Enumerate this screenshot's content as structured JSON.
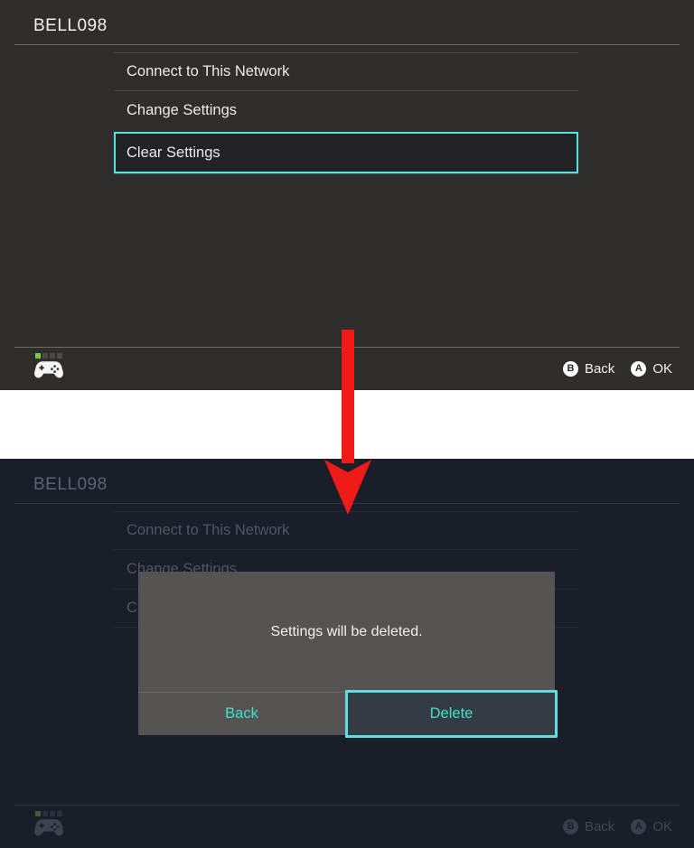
{
  "panels": [
    {
      "id": "menu-panel",
      "title": "BELL098",
      "menu": [
        {
          "label": "Connect to This Network",
          "selected": false
        },
        {
          "label": "Change Settings",
          "selected": false
        },
        {
          "label": "Clear Settings",
          "selected": true
        }
      ],
      "action_bar": {
        "controller_icon": "game-controller-icon",
        "player_leds": [
          true,
          false,
          false,
          false
        ],
        "hints": [
          {
            "button": "B",
            "label": "Back"
          },
          {
            "button": "A",
            "label": "OK"
          }
        ]
      }
    },
    {
      "id": "dialog-panel",
      "title": "BELL098",
      "menu": [
        {
          "label": "Connect to This Network",
          "selected": false
        },
        {
          "label": "Change Settings",
          "selected": false
        },
        {
          "label": "Clear Settings",
          "selected": false
        }
      ],
      "dialog": {
        "message": "Settings will be deleted.",
        "buttons": [
          {
            "label": "Back",
            "focused": false
          },
          {
            "label": "Delete",
            "focused": true
          }
        ]
      },
      "action_bar": {
        "controller_icon": "game-controller-icon",
        "player_leds": [
          true,
          false,
          false,
          false
        ],
        "hints": [
          {
            "button": "B",
            "label": "Back"
          },
          {
            "button": "A",
            "label": "OK"
          }
        ]
      }
    }
  ],
  "annotation": {
    "arrow": "down-arrow-annotation",
    "color": "#ee1b18"
  },
  "colors": {
    "accent_cyan": "#53e3e6",
    "dialog_action_text": "#3fe0d0",
    "panel_top_bg": "#302e2d",
    "panel_bottom_bg": "#1a1e28",
    "dialog_bg": "#565452",
    "led_on": "#7ac943"
  }
}
